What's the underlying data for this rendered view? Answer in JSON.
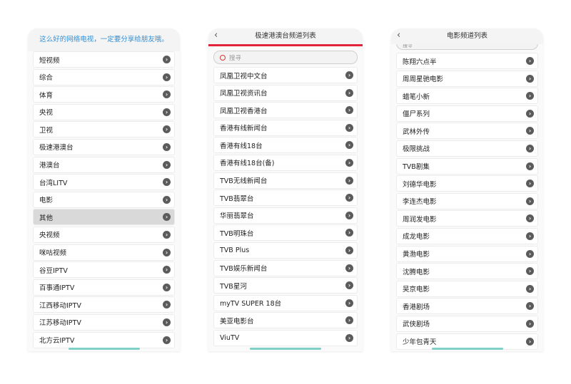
{
  "left_panel": {
    "message": "这么好的网络电视，一定要分享给朋友哦。",
    "highlighted_index": 9,
    "items": [
      "短视频",
      "综合",
      "体育",
      "央视",
      "卫视",
      "极速港澳台",
      "港澳台",
      "台湾LITV",
      "电影",
      "其他",
      "央视频",
      "咪咕视频",
      "谷豆IPTV",
      "百事通IPTV",
      "江西移动IPTV",
      "江苏移动IPTV",
      "北方云IPTV"
    ]
  },
  "middle_panel": {
    "back_glyph": "‹",
    "title": "极速港澳台频道列表",
    "search_placeholder": "搜寻",
    "items": [
      "凤凰卫视中文台",
      "凤凰卫视资讯台",
      "凤凰卫视香港台",
      "香港有线新闻台",
      "香港有线18台",
      "香港有线18台(备)",
      "TVB无线新闻台",
      "TVB翡翠台",
      "华丽翡翠台",
      "TVB明珠台",
      "TVB Plus",
      "TVB娱乐新闻台",
      "TVB星河",
      "myTV SUPER 18台",
      "美亚电影台",
      "ViuTV"
    ]
  },
  "right_panel": {
    "back_glyph": "‹",
    "title": "电影频道列表",
    "search_placeholder": "搜寻",
    "items": [
      "陈翔六点半",
      "周周星驰电影",
      "蜡笔小新",
      "僵尸系列",
      "武林外传",
      "极限挑战",
      "TVB剧集",
      "刘德华电影",
      "李连杰电影",
      "周润发电影",
      "成龙电影",
      "黄渤电影",
      "沈腾电影",
      "吴京电影",
      "香港剧场",
      "武侠剧场",
      "少年包青天"
    ]
  },
  "chevron_glyph": "›",
  "colors": {
    "accent_red": "#e2243a",
    "message_blue": "#2f8fd6",
    "home_indicator": "#7fd0c7"
  }
}
